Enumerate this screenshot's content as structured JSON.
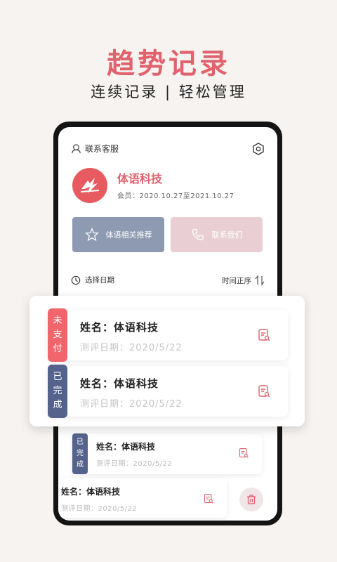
{
  "header": {
    "title": "趋势记录",
    "subtitle": "连续记录 | 轻松管理"
  },
  "app": {
    "customer_service": "联系客服",
    "brand_name": "体语科技",
    "membership": "会员：2020.10.27至2021.10.27",
    "buttons": {
      "recommend": "体语相关推荐",
      "contact": "联系我们"
    },
    "select_date": "选择日期",
    "sort_label": "时间正序"
  },
  "records": [
    {
      "status": [
        "未",
        "支",
        "付"
      ],
      "status_color": "#f0666c",
      "name": "姓名：体语科技",
      "date": "测评日期：2020/5/22"
    },
    {
      "status": [
        "已",
        "完",
        "成"
      ],
      "status_color": "#55638c",
      "name": "姓名：体语科技",
      "date": "测评日期：2020/5/22"
    }
  ],
  "background_records": [
    {
      "status": [
        "已",
        "完",
        "成"
      ],
      "name": "姓名：体语科技",
      "date": "测评日期：2020/5/22"
    },
    {
      "name": "姓名：体语科技",
      "date": "测评日期：2020/5/22"
    }
  ],
  "colors": {
    "accent": "#e0626c",
    "blue_button": "#8d9ab1",
    "pink_button": "#e9cfd3"
  }
}
